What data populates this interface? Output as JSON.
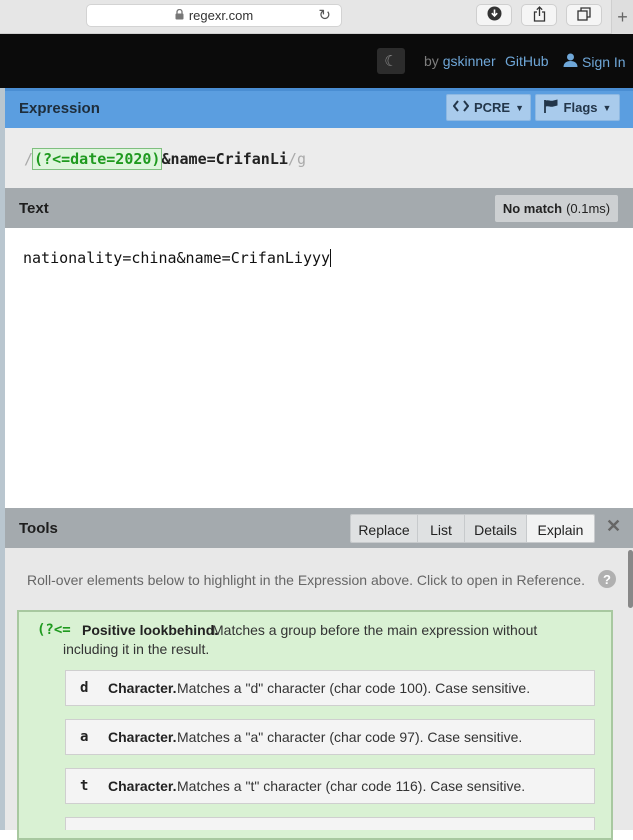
{
  "browser": {
    "url": "regexr.com",
    "icons": [
      "lock-icon",
      "reload-icon",
      "download-icon",
      "share-icon",
      "tabs-icon",
      "plus-icon"
    ]
  },
  "header": {
    "by_prefix": "by",
    "author": "gskinner",
    "github": "GitHub",
    "sign_in": "Sign In"
  },
  "expression": {
    "title": "Expression",
    "engine_label": "PCRE",
    "flags_label": "Flags",
    "open_delim": "/",
    "group": "(?<=date=2020)",
    "rest": "&name=CrifanLi",
    "close_delim": "/",
    "flags": "g"
  },
  "text": {
    "title": "Text",
    "match_status": "No match",
    "match_time": "(0.1ms)",
    "content": "nationality=china&name=CrifanLiyyy"
  },
  "tools": {
    "title": "Tools",
    "tabs": [
      {
        "label": "Replace"
      },
      {
        "label": "List"
      },
      {
        "label": "Details"
      },
      {
        "label": "Explain"
      }
    ],
    "active_tab": "Explain",
    "hint": "Roll-over elements below to highlight in the Expression above. Click to open in Reference.",
    "explain": {
      "token": "(?<=",
      "name": "Positive lookbehind.",
      "desc_line1": "Matches a group before the main expression without",
      "desc_line2": "including it in the result.",
      "children": [
        {
          "token": "d",
          "name": "Character.",
          "desc": "Matches a \"d\" character (char code 100). Case sensitive."
        },
        {
          "token": "a",
          "name": "Character.",
          "desc": "Matches a \"a\" character (char code 97). Case sensitive."
        },
        {
          "token": "t",
          "name": "Character.",
          "desc": "Matches a \"t\" character (char code 116). Case sensitive."
        }
      ]
    }
  },
  "colors": {
    "expression_header": "#5b9ee0",
    "section_header": "#a4aaae",
    "app_header": "#0b0b0b",
    "group_highlight": "#1f9a1f",
    "explain_bg": "#d9f1d3"
  }
}
